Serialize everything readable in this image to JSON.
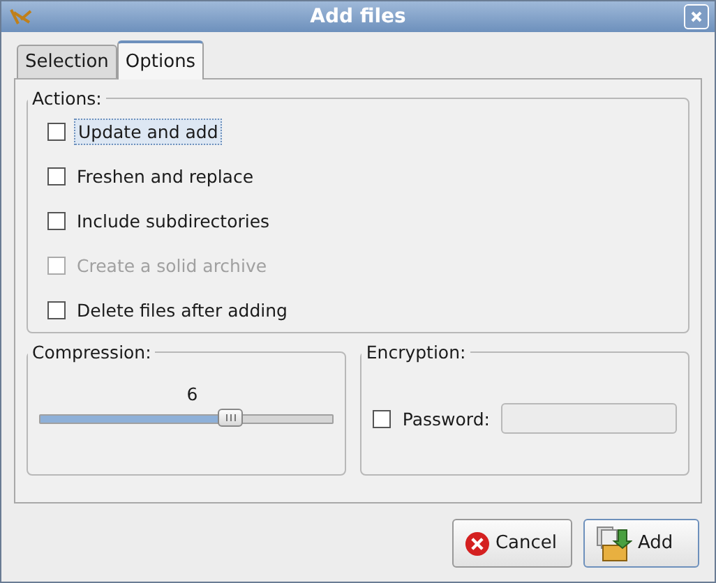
{
  "window": {
    "title": "Add files"
  },
  "tabs": [
    {
      "label": "Selection",
      "selected": false
    },
    {
      "label": "Options",
      "selected": true
    }
  ],
  "actions": {
    "title": "Actions:",
    "options": [
      {
        "label": "Update and add",
        "checked": false,
        "disabled": false,
        "focused": true
      },
      {
        "label": "Freshen and replace",
        "checked": false,
        "disabled": false,
        "focused": false
      },
      {
        "label": "Include subdirectories",
        "checked": false,
        "disabled": false,
        "focused": false
      },
      {
        "label": "Create a solid archive",
        "checked": false,
        "disabled": true,
        "focused": false
      },
      {
        "label": "Delete files after adding",
        "checked": false,
        "disabled": false,
        "focused": false
      }
    ]
  },
  "compression": {
    "title": "Compression:",
    "reading": "6",
    "level": 0.65
  },
  "encryption": {
    "title": "Encryption:",
    "password_label": "Password:",
    "checked": false,
    "field_disabled": true
  },
  "buttons": [
    {
      "kind": "cancel",
      "label": "Cancel"
    },
    {
      "kind": "add",
      "label": "Add"
    }
  ]
}
